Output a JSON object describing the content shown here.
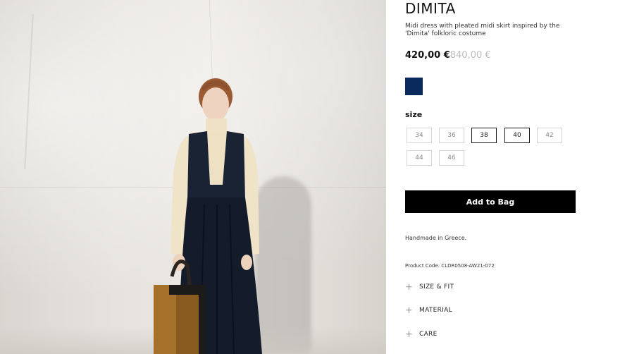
{
  "product": {
    "name": "DIMITA",
    "description": "Midi dress with pleated midi skirt inspired by the 'Dimita' folkloric costume",
    "price_current": "420,00 €",
    "price_original": "840,00 €"
  },
  "colors": [
    {
      "name": "navy",
      "hex": "#0a2a5e",
      "selected": true
    }
  ],
  "size": {
    "label": "size",
    "options": [
      {
        "value": "34",
        "available": false
      },
      {
        "value": "36",
        "available": false
      },
      {
        "value": "38",
        "available": true
      },
      {
        "value": "40",
        "available": true
      },
      {
        "value": "42",
        "available": false
      },
      {
        "value": "44",
        "available": false
      },
      {
        "value": "46",
        "available": false
      }
    ]
  },
  "cart": {
    "add_label": "Add to Bag"
  },
  "details": {
    "handmade": "Handmade in Greece.",
    "product_code": "Product Code: CLDR0508-AW21-072"
  },
  "accordions": [
    {
      "label": "SIZE & FIT",
      "icon": "plus-icon"
    },
    {
      "label": "MATERIAL",
      "icon": "plus-icon"
    },
    {
      "label": "CARE",
      "icon": "plus-icon"
    }
  ]
}
